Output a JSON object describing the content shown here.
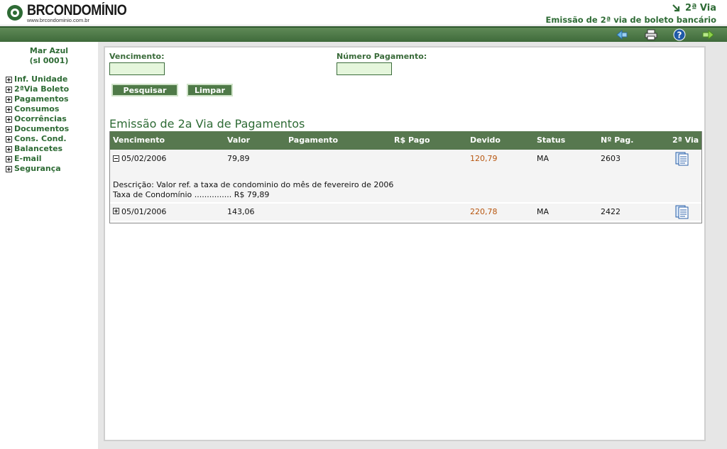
{
  "header": {
    "logo_name": "BRCONDOMÍNIO",
    "logo_url": "www.brcondominio.com.br",
    "title": "2ª Via",
    "subtitle": "Emissão de 2ª via de boleto bancário"
  },
  "toolbar": {
    "icons": [
      "back-arrow-icon",
      "printer-icon",
      "help-icon",
      "forward-arrow-icon"
    ]
  },
  "sidebar": {
    "unit_name": "Mar Azul",
    "unit_code": "(sl 0001)",
    "items": [
      {
        "label": "Inf. Unidade"
      },
      {
        "label": "2ªVia Boleto"
      },
      {
        "label": "Pagamentos"
      },
      {
        "label": "Consumos"
      },
      {
        "label": "Ocorrências"
      },
      {
        "label": "Documentos"
      },
      {
        "label": "Cons. Cond."
      },
      {
        "label": "Balancetes"
      },
      {
        "label": "E-mail"
      },
      {
        "label": "Segurança"
      }
    ]
  },
  "search": {
    "vencimento_label": "Vencimento:",
    "vencimento_value": "",
    "numero_label": "Número Pagamento:",
    "numero_value": "",
    "pesquisar_label": "Pesquisar",
    "limpar_label": "Limpar"
  },
  "results": {
    "title": "Emissão de 2a Via de Pagamentos",
    "columns": [
      "Vencimento",
      "Valor",
      "Pagamento",
      "R$ Pago",
      "Devido",
      "Status",
      "Nº Pag.",
      "2ª Via"
    ],
    "rows": [
      {
        "vencimento": "05/02/2006",
        "valor": "79,89",
        "pagamento": "",
        "pago": "",
        "devido": "120,79",
        "status": "MA",
        "num_pag": "2603",
        "expanded": true,
        "descricao": "Descrição: Valor ref. a taxa de condominio do mês de fevereiro de 2006",
        "detalhe": "Taxa de Condomínio ............... R$ 79,89"
      },
      {
        "vencimento": "05/01/2006",
        "valor": "143,06",
        "pagamento": "",
        "pago": "",
        "devido": "220,78",
        "status": "MA",
        "num_pag": "2422",
        "expanded": false
      }
    ]
  },
  "colors": {
    "brand_green": "#2e6b35",
    "header_bar": "#57784f",
    "input_bg": "#e5f6dc",
    "due_value": "#b8560f"
  }
}
